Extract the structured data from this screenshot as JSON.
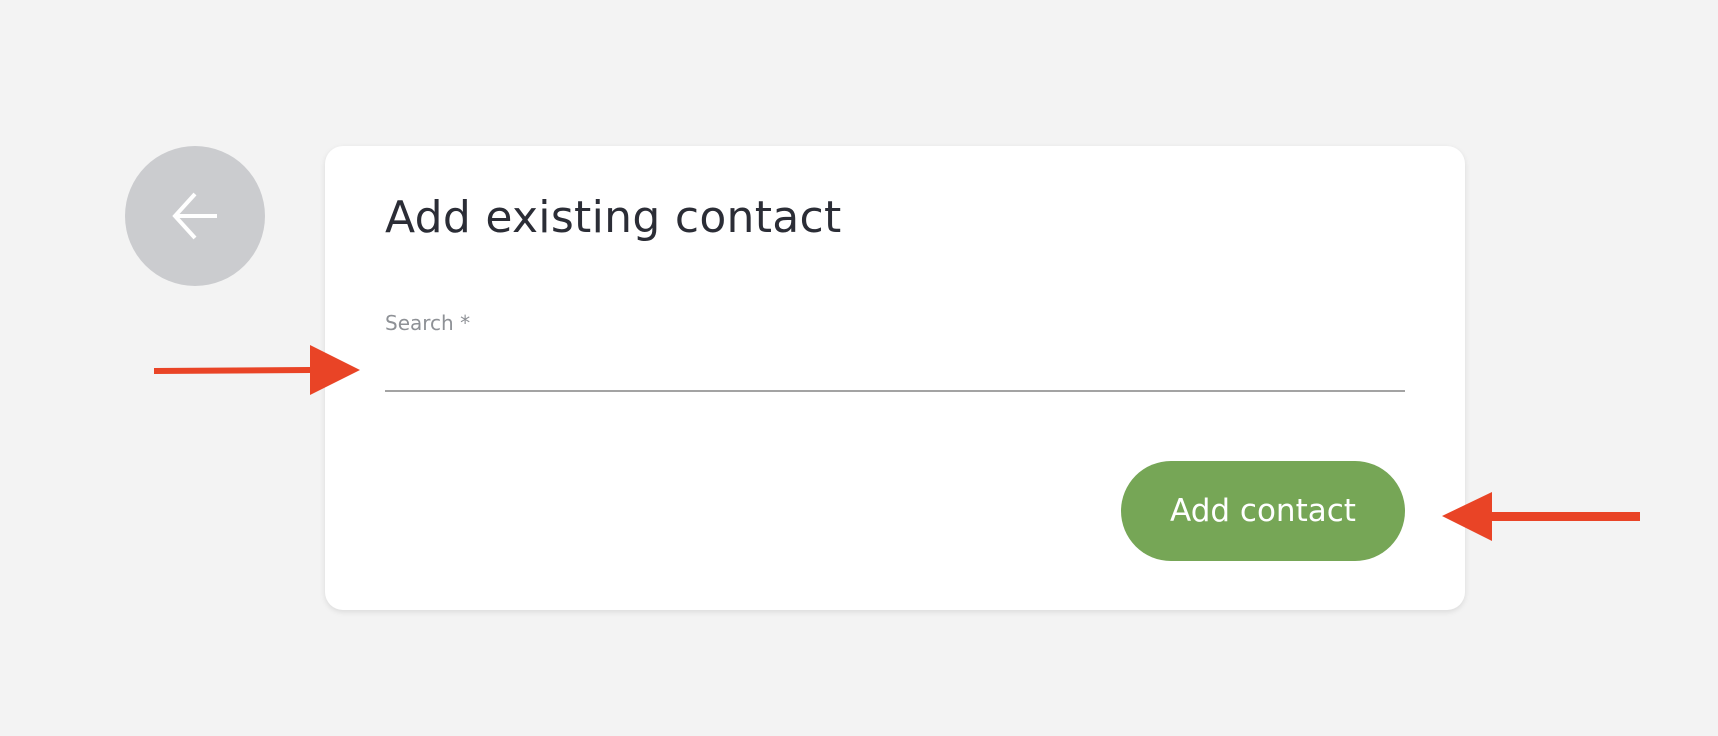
{
  "page": {
    "background": "#f3f3f3"
  },
  "back_button": {
    "icon": "arrow-left-icon",
    "color": "#cbcccf"
  },
  "card": {
    "title": "Add existing contact",
    "search": {
      "label": "Search *",
      "value": ""
    },
    "add_button": {
      "label": "Add contact",
      "color": "#76a656"
    }
  },
  "annotations": {
    "arrow_color": "#e94426",
    "items": [
      {
        "name": "annotation-arrow-to-search",
        "direction": "right",
        "target": "search-input"
      },
      {
        "name": "annotation-arrow-to-add-button",
        "direction": "left",
        "target": "add-contact-button"
      }
    ]
  }
}
